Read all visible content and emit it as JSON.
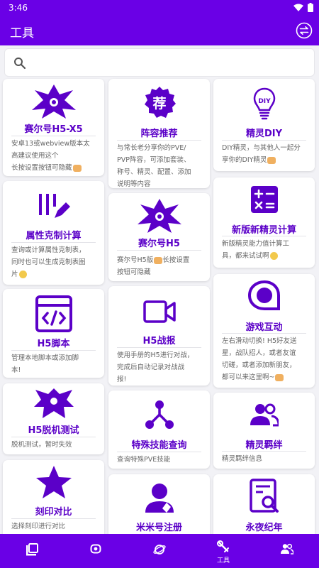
{
  "status": {
    "time": "3:46"
  },
  "app_bar": {
    "title": "工具"
  },
  "search": {
    "placeholder": ""
  },
  "colors": {
    "primary": "#6a00e6",
    "accent_text": "#5b00c8"
  },
  "cards": {
    "c1": {
      "title": "赛尔号H5-X5",
      "desc1": "安卓13或webview版本太",
      "desc2": "高建议使用这个",
      "desc3": "长按设置按钮可隐藏",
      "icon": "seer-robot-icon"
    },
    "c2": {
      "title": "阵容推荐",
      "desc1": "与常长老分享你的PVE/",
      "desc2": "PVP阵容，可添加套装、",
      "desc3": "称号、精灵、配置、添加",
      "desc4": "说明等内容",
      "icon": "recommend-badge-icon",
      "badge_char": "荐"
    },
    "c3": {
      "title": "精灵DIY",
      "desc1": "DIY精灵，与其他人一起分",
      "desc2": "享你的DIY精灵",
      "icon": "diy-lightbulb-icon",
      "badge_text": "DIY"
    },
    "c4": {
      "title": "属性克制计算",
      "desc1": "查询或计算属性克制表，",
      "desc2": "同时也可以生成克制表图",
      "desc3": "片",
      "icon": "chart-edit-icon"
    },
    "c5": {
      "title": "赛尔号H5",
      "desc1": "赛尔号H5版",
      "desc1b": "长按设置",
      "desc2": "按钮可隐藏",
      "icon": "seer-robot-icon"
    },
    "c6": {
      "title": "新版新精灵计算",
      "desc1": "新版精灵能力值计算工",
      "desc2": "具，都来试试啊",
      "icon": "calculator-icon"
    },
    "c7": {
      "title": "H5脚本",
      "desc1": "管理本地脚本或添加脚",
      "desc2": "本!",
      "icon": "code-window-icon"
    },
    "c8": {
      "title": "H5战报",
      "desc1": "使用手册的H5进行对战，",
      "desc2": "完成后自动记录对战战",
      "desc3": "报!",
      "icon": "video-camera-icon"
    },
    "c9": {
      "title": "游戏互动",
      "desc1": "左右滑动切换! H5好友送",
      "desc2": "星，战队招人，或者友谊",
      "desc3": "切磋，或者添加新朋友，",
      "desc4": "都可以来这里啊~",
      "icon": "chat-bubble-icon"
    },
    "c10": {
      "title": "H5脱机测试",
      "desc1": "脱机测试，暂时失效",
      "icon": "dragon-emblem-icon"
    },
    "c11": {
      "title": "特殊技能查询",
      "desc1": "查询特殊PVE技能",
      "icon": "network-tree-icon"
    },
    "c12": {
      "title": "精灵羁绊",
      "desc1": "精灵羁绊信息",
      "icon": "people-group-icon"
    },
    "c13": {
      "title": "刻印对比",
      "desc1": "选择刻印进行对比",
      "icon": "star-emblem-icon"
    },
    "c14": {
      "title": "米米号注册",
      "icon": "user-avatar-icon"
    },
    "c15": {
      "title": "永夜纪年",
      "icon": "book-search-icon"
    }
  },
  "nav": {
    "items": [
      {
        "icon": "book-library-icon",
        "label": ""
      },
      {
        "icon": "capsule-icon",
        "label": ""
      },
      {
        "icon": "planet-icon",
        "label": ""
      },
      {
        "icon": "tools-wrench-icon",
        "label": "工具",
        "active": true
      },
      {
        "icon": "people-icon",
        "label": ""
      }
    ]
  }
}
